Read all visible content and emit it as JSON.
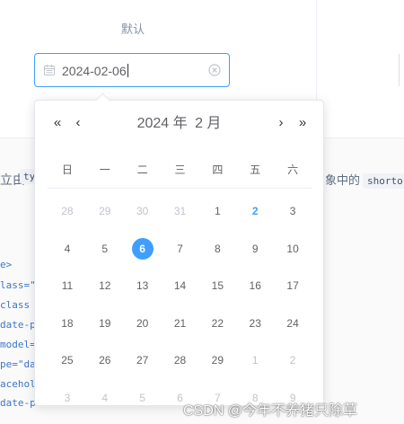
{
  "demo": {
    "label": "默认",
    "input_value": "2024-02-06"
  },
  "description": {
    "left_text": "立由",
    "left_chip": "ty",
    "right_text": "象中的",
    "right_chip": "shorto"
  },
  "code_lines": [
    "e>",
    "lass=\"b",
    " class",
    "date-pi",
    "model=\"",
    "pe=\"date",
    "aceholc",
    "date-p"
  ],
  "picker": {
    "prev_year": "«",
    "prev_month": "‹",
    "next_month": "›",
    "next_year": "»",
    "year_label": "2024 年",
    "month_label": "2 月",
    "weekdays": [
      "日",
      "一",
      "二",
      "三",
      "四",
      "五",
      "六"
    ],
    "weeks": [
      [
        {
          "d": "28",
          "t": "other"
        },
        {
          "d": "29",
          "t": "other"
        },
        {
          "d": "30",
          "t": "other"
        },
        {
          "d": "31",
          "t": "other"
        },
        {
          "d": "1",
          "t": "normal"
        },
        {
          "d": "2",
          "t": "today"
        },
        {
          "d": "3",
          "t": "normal"
        }
      ],
      [
        {
          "d": "4",
          "t": "normal"
        },
        {
          "d": "5",
          "t": "normal"
        },
        {
          "d": "6",
          "t": "selected"
        },
        {
          "d": "7",
          "t": "normal"
        },
        {
          "d": "8",
          "t": "normal"
        },
        {
          "d": "9",
          "t": "normal"
        },
        {
          "d": "10",
          "t": "normal"
        }
      ],
      [
        {
          "d": "11",
          "t": "normal"
        },
        {
          "d": "12",
          "t": "normal"
        },
        {
          "d": "13",
          "t": "normal"
        },
        {
          "d": "14",
          "t": "normal"
        },
        {
          "d": "15",
          "t": "normal"
        },
        {
          "d": "16",
          "t": "normal"
        },
        {
          "d": "17",
          "t": "normal"
        }
      ],
      [
        {
          "d": "18",
          "t": "normal"
        },
        {
          "d": "19",
          "t": "normal"
        },
        {
          "d": "20",
          "t": "normal"
        },
        {
          "d": "21",
          "t": "normal"
        },
        {
          "d": "22",
          "t": "normal"
        },
        {
          "d": "23",
          "t": "normal"
        },
        {
          "d": "24",
          "t": "normal"
        }
      ],
      [
        {
          "d": "25",
          "t": "normal"
        },
        {
          "d": "26",
          "t": "normal"
        },
        {
          "d": "27",
          "t": "normal"
        },
        {
          "d": "28",
          "t": "normal"
        },
        {
          "d": "29",
          "t": "normal"
        },
        {
          "d": "1",
          "t": "other"
        },
        {
          "d": "2",
          "t": "other"
        }
      ],
      [
        {
          "d": "3",
          "t": "other"
        },
        {
          "d": "4",
          "t": "other"
        },
        {
          "d": "5",
          "t": "other"
        },
        {
          "d": "6",
          "t": "other"
        },
        {
          "d": "7",
          "t": "other"
        },
        {
          "d": "8",
          "t": "other"
        },
        {
          "d": "9",
          "t": "other"
        }
      ]
    ]
  },
  "watermark": "CSDN @今年不养猪只除草",
  "colors": {
    "accent": "#409eff",
    "text": "#606266",
    "muted": "#c0c4cc"
  },
  "icons": {
    "input_prefix": "calendar-icon",
    "input_suffix": "clear-icon"
  }
}
